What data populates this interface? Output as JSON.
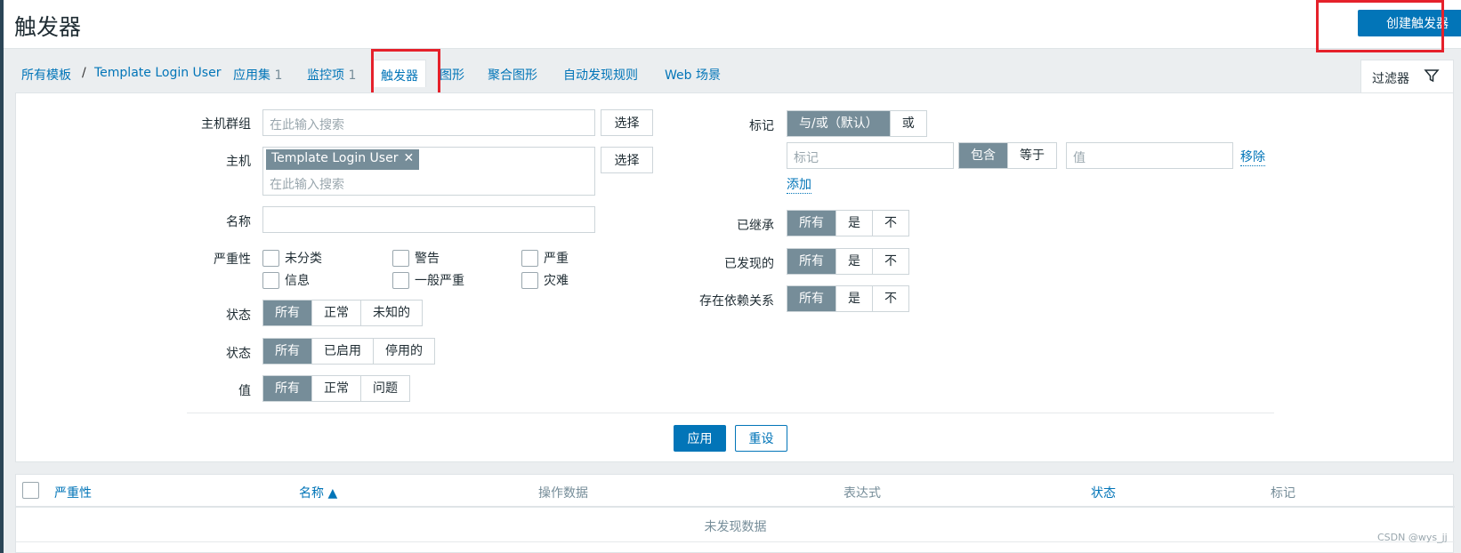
{
  "header": {
    "title": "触发器",
    "create_button": "创建触发器"
  },
  "breadcrumb": {
    "all_templates": "所有模板",
    "separator": "/",
    "template": "Template Login User",
    "tabs": [
      {
        "label": "应用集",
        "count": "1"
      },
      {
        "label": "监控项",
        "count": "1"
      },
      {
        "label": "触发器",
        "count": ""
      },
      {
        "label": "图形",
        "count": ""
      },
      {
        "label": "聚合图形",
        "count": ""
      },
      {
        "label": "自动发现规则",
        "count": ""
      },
      {
        "label": "Web 场景",
        "count": ""
      }
    ]
  },
  "filter_tab": {
    "label": "过滤器",
    "icon": "funnel-icon"
  },
  "filter": {
    "host_group": {
      "label": "主机群组",
      "placeholder": "在此输入搜索",
      "select": "选择"
    },
    "host": {
      "label": "主机",
      "tag": "Template Login User",
      "placeholder": "在此输入搜索",
      "select": "选择"
    },
    "name": {
      "label": "名称",
      "value": ""
    },
    "severity": {
      "label": "严重性",
      "options": [
        "未分类",
        "警告",
        "严重",
        "信息",
        "一般严重",
        "灾难"
      ]
    },
    "state": {
      "label": "状态",
      "options": [
        "所有",
        "正常",
        "未知的"
      ],
      "selected": "所有"
    },
    "status": {
      "label": "状态",
      "options": [
        "所有",
        "已启用",
        "停用的"
      ],
      "selected": "所有"
    },
    "value": {
      "label": "值",
      "options": [
        "所有",
        "正常",
        "问题"
      ],
      "selected": "所有"
    },
    "tags": {
      "label": "标记",
      "mode_options": [
        "与/或（默认）",
        "或"
      ],
      "mode_selected": "与/或（默认）",
      "tag_placeholder": "标记",
      "operator_options": [
        "包含",
        "等于"
      ],
      "operator_selected": "包含",
      "value_placeholder": "值",
      "remove": "移除",
      "add": "添加"
    },
    "inherited": {
      "label": "已继承",
      "options": [
        "所有",
        "是",
        "不"
      ],
      "selected": "所有"
    },
    "discovered": {
      "label": "已发现的",
      "options": [
        "所有",
        "是",
        "不"
      ],
      "selected": "所有"
    },
    "dependencies": {
      "label": "存在依赖关系",
      "options": [
        "所有",
        "是",
        "不"
      ],
      "selected": "所有"
    },
    "apply": "应用",
    "reset": "重设"
  },
  "table": {
    "columns": [
      "严重性",
      "名称 ▲",
      "操作数据",
      "表达式",
      "状态",
      "标记"
    ],
    "empty": "未发现数据"
  },
  "watermark": "CSDN @wys_jj"
}
